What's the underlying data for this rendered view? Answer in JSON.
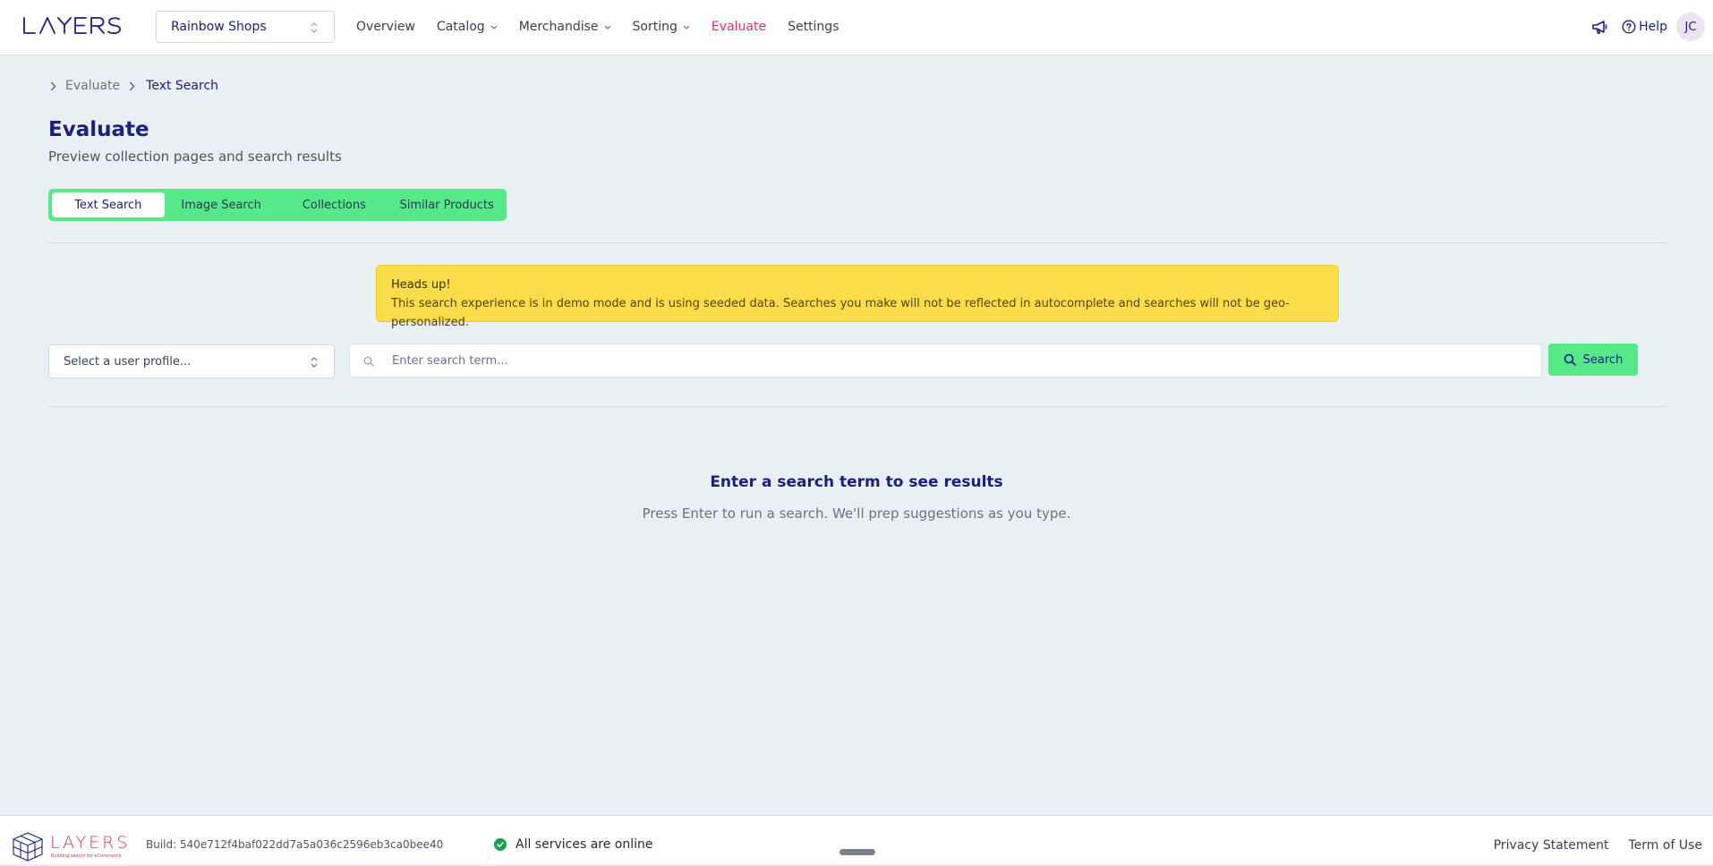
{
  "header": {
    "logo_text": "LAYERS",
    "shop_selector": "Rainbow Shops",
    "nav": [
      {
        "label": "Overview",
        "has_dropdown": false,
        "active": false
      },
      {
        "label": "Catalog",
        "has_dropdown": true,
        "active": false
      },
      {
        "label": "Merchandise",
        "has_dropdown": true,
        "active": false
      },
      {
        "label": "Sorting",
        "has_dropdown": true,
        "active": false
      },
      {
        "label": "Evaluate",
        "has_dropdown": false,
        "active": true
      },
      {
        "label": "Settings",
        "has_dropdown": false,
        "active": false
      }
    ],
    "announcements_icon": "megaphone-icon",
    "help_label": "Help",
    "avatar_initials": "JC"
  },
  "breadcrumb": {
    "items": [
      "Evaluate",
      "Text Search"
    ]
  },
  "page": {
    "title": "Evaluate",
    "subtitle": "Preview collection pages and search results"
  },
  "tabs": [
    {
      "label": "Text Search",
      "active": true
    },
    {
      "label": "Image Search",
      "active": false
    },
    {
      "label": "Collections",
      "active": false
    },
    {
      "label": "Similar Products",
      "active": false
    }
  ],
  "alert": {
    "title": "Heads up!",
    "message": "This search experience is in demo mode and is using seeded data. Searches you make will not be reflected in autocomplete and searches will not be geo-personalized."
  },
  "search": {
    "profile_placeholder": "Select a user profile...",
    "input_placeholder": "Enter search term...",
    "input_value": "",
    "button_label": "Search"
  },
  "empty_state": {
    "title": "Enter a search term to see results",
    "subtitle": "Press Enter to run a search. We'll prep suggestions as you type."
  },
  "footer": {
    "logo_text": "LAYERS",
    "logo_tagline": "Building search for eCommerce",
    "build": "Build: 540e712f4baf022dd7a5a036c2596eb3ca0bee40",
    "status": "All services are online",
    "links": [
      "Privacy Statement",
      "Term of Use"
    ]
  },
  "colors": {
    "brand_navy": "#1b2180",
    "accent_pink": "#e0325a",
    "accent_green": "#56e889",
    "alert_yellow": "#fbdd4b",
    "status_green": "#16a34a",
    "page_bg": "#e8f0f3"
  }
}
